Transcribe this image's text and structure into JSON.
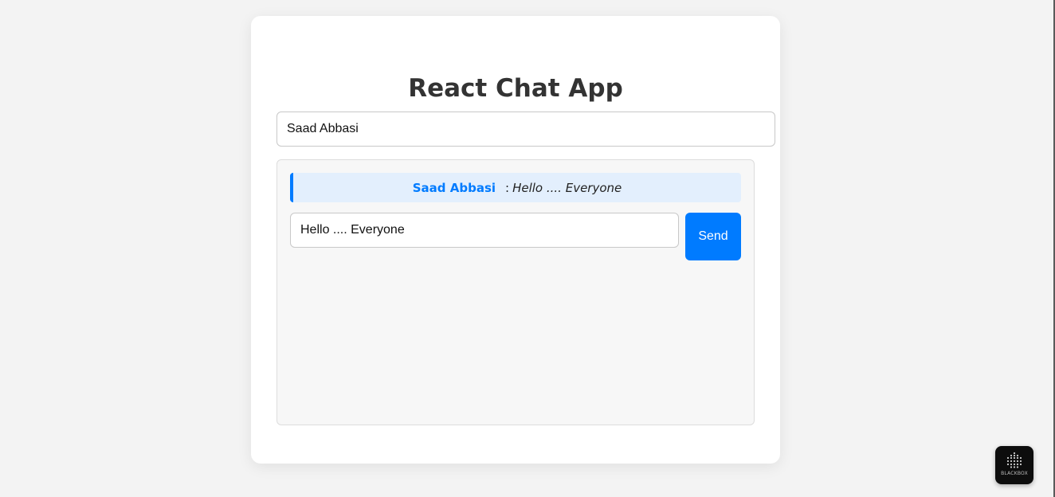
{
  "app": {
    "title": "React Chat App"
  },
  "username_field": {
    "value": "Saad Abbasi"
  },
  "messages": [
    {
      "user": "Saad Abbasi",
      "separator": ":",
      "text": "Hello .... Everyone"
    }
  ],
  "composer": {
    "value": "Hello .... Everyone",
    "send_label": "Send"
  },
  "badge": {
    "label": "BLACKBOX",
    "icon": "blackbox-logo-icon"
  },
  "colors": {
    "accent": "#007bff",
    "message_bg": "#e3effd",
    "title": "#333333",
    "page_bg": "#f3f3f3"
  }
}
